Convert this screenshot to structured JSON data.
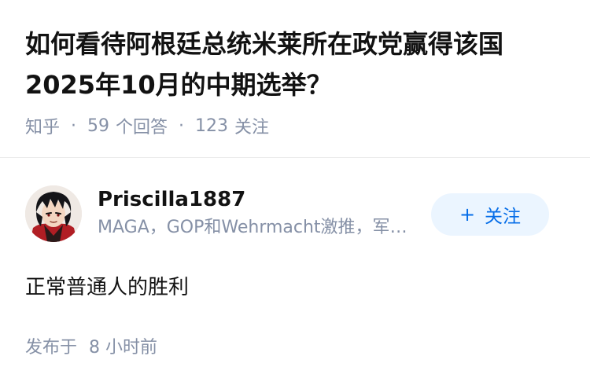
{
  "question": {
    "title": "如何看待阿根廷总统米莱所在政党赢得该国2025年10月的中期选举？",
    "site": "知乎",
    "answer_count": "59",
    "answer_count_label": "个回答",
    "follower_count": "123",
    "follower_count_label": "关注",
    "separator": "·"
  },
  "answer": {
    "author": {
      "name": "Priscilla1887",
      "bio": "MAGA，GOP和Wehrmacht激推，军事爱好者",
      "avatar_icon": "avatar-anime-character"
    },
    "follow_button": {
      "plus": "+",
      "label": "关注"
    },
    "content": "正常普通人的胜利",
    "time": {
      "prefix": "发布于",
      "value": "8 小时前"
    }
  },
  "colors": {
    "text_primary": "#121212",
    "text_secondary": "#8590a6",
    "follow_bg": "#ebf5ff",
    "follow_text": "#056de8",
    "divider": "#ebebeb"
  }
}
